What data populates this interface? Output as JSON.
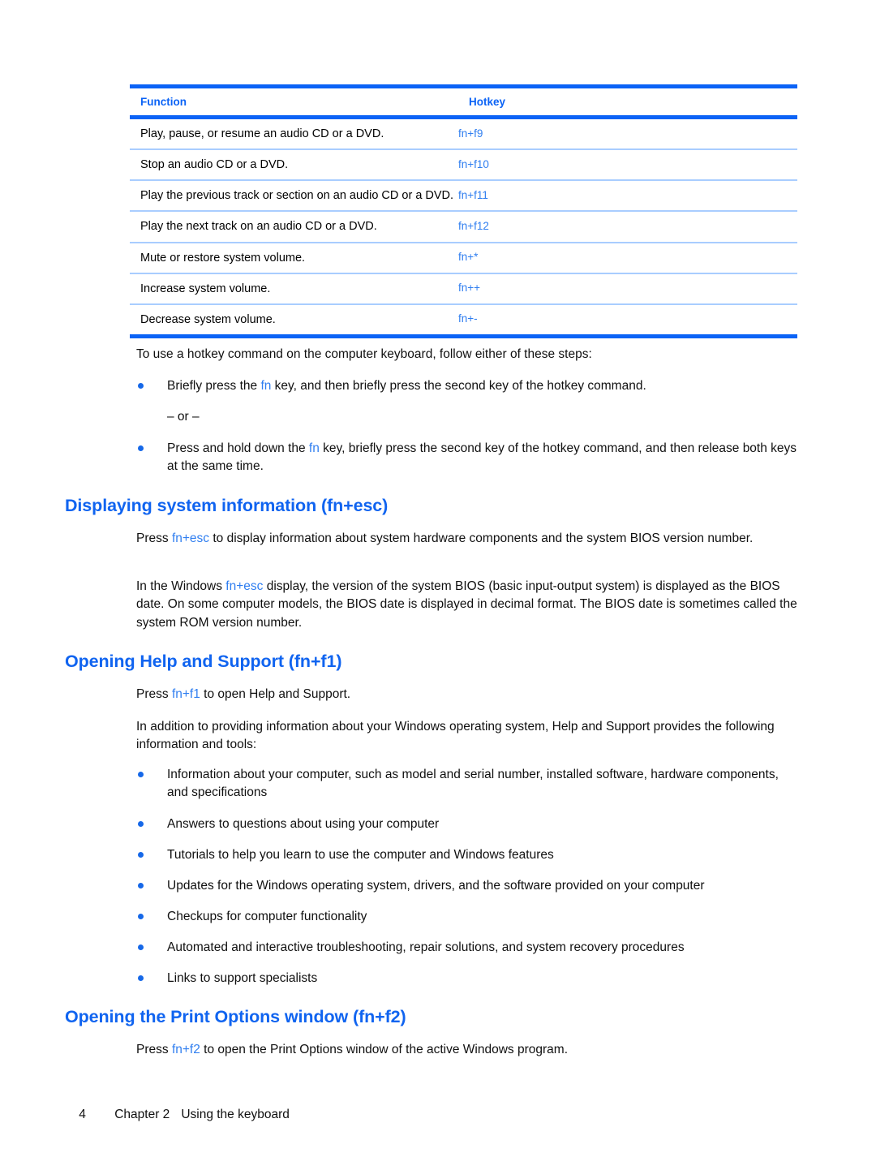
{
  "document": {
    "table": {
      "columns": [
        "Function",
        "Hotkey"
      ],
      "rows": [
        {
          "function": "Play, pause, or resume an audio CD or a DVD.",
          "hotkey": "fn+f9"
        },
        {
          "function": "Stop an audio CD or a DVD.",
          "hotkey": "fn+f10"
        },
        {
          "function": "Play the previous track or section on an audio CD or a DVD.",
          "hotkey": "fn+f11"
        },
        {
          "function": "Play the next track on an audio CD or a DVD.",
          "hotkey": "fn+f12"
        },
        {
          "function": "Mute or restore system volume.",
          "hotkey": "fn+*"
        },
        {
          "function": "Increase system volume.",
          "hotkey": "fn++"
        },
        {
          "function": "Decrease system volume.",
          "hotkey": "fn+-"
        }
      ]
    },
    "intro": {
      "lead": "To use a hotkey command on the computer keyboard, follow either of these steps:",
      "bullet1_pre": "Briefly press the ",
      "bullet1_key": "fn",
      "bullet1_post": " key, and then briefly press the second key of the hotkey command.",
      "or_separator": "– or –",
      "bullet2_pre": "Press and hold down the ",
      "bullet2_key": "fn",
      "bullet2_post": " key, briefly press the second key of the hotkey command, and then release both keys at the same time."
    },
    "section_sysinfo": {
      "heading": "Displaying system information (fn+esc)",
      "p1_pre": "Press ",
      "p1_key": "fn+esc",
      "p1_post": " to display information about system hardware components and the system BIOS version number.",
      "p2_pre": "In the Windows ",
      "p2_key": "fn+esc",
      "p2_post": " display, the version of the system BIOS (basic input-output system) is displayed as the BIOS date. On some computer models, the BIOS date is displayed in decimal format. The BIOS date is sometimes called the system ROM version number."
    },
    "section_help": {
      "heading": "Opening Help and Support (fn+f1)",
      "p1_pre": "Press ",
      "p1_key": "fn+f1",
      "p1_post": " to open Help and Support.",
      "p2": "In addition to providing information about your Windows operating system, Help and Support provides the following information and tools:",
      "bullets": [
        "Information about your computer, such as model and serial number, installed software, hardware components, and specifications",
        "Answers to questions about using your computer",
        "Tutorials to help you learn to use the computer and Windows features",
        "Updates for the Windows operating system, drivers, and the software provided on your computer",
        "Checkups for computer functionality",
        "Automated and interactive troubleshooting, repair solutions, and system recovery procedures",
        "Links to support specialists"
      ]
    },
    "section_print": {
      "heading": "Opening the Print Options window (fn+f2)",
      "p1_pre": "Press ",
      "p1_key": "fn+f2",
      "p1_post": " to open the Print Options window of the active Windows program."
    },
    "footer": {
      "page_number": "4",
      "chapter": "Chapter 2",
      "title": "Using the keyboard"
    },
    "colors": {
      "heading_blue": "#1064f0",
      "rule_blue": "#0b63f6",
      "row_rule_blue": "#a9cdff",
      "inline_key_blue": "#2f7ef0",
      "bullet_blue": "#1668e8"
    }
  }
}
